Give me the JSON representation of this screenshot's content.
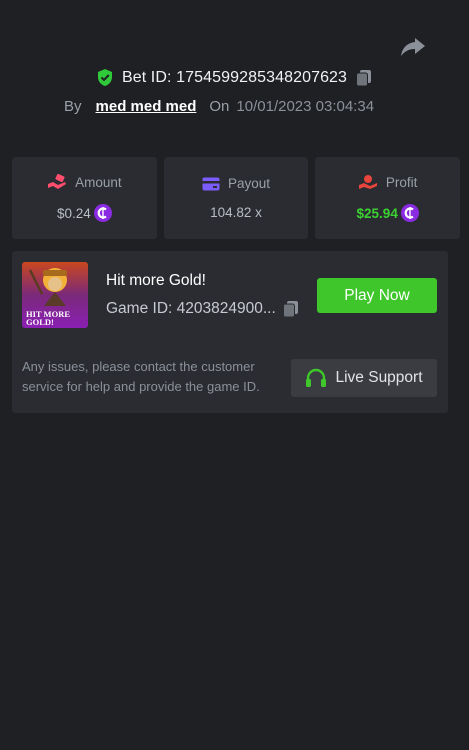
{
  "header": {
    "bet_label": "Bet ID: 1754599285348207623",
    "by_label": "By",
    "username": "med med med",
    "on_label": "On",
    "datetime": "10/01/2023 03:04:34"
  },
  "stats": {
    "amount": {
      "label": "Amount",
      "value": "$0.24",
      "icon": "hand-coins-icon"
    },
    "payout": {
      "label": "Payout",
      "value": "104.82 x",
      "icon": "card-icon"
    },
    "profit": {
      "label": "Profit",
      "value": "$25.94",
      "icon": "hand-money-icon"
    }
  },
  "game": {
    "thumb_text_1": "HIT MORE",
    "thumb_text_2": "GOLD!",
    "title": "Hit more Gold!",
    "game_id": "Game ID: 4203824900...",
    "play_label": "Play Now",
    "support_text": "Any issues, please contact the customer service for help and provide the game ID.",
    "support_label": "Live Support"
  },
  "colors": {
    "background": "#1f2024",
    "panel": "#2a2c31",
    "accent_green": "#3ec62a",
    "profit_green": "#3cd132",
    "coin_purple": "#8a2be2",
    "amount_icon": "#ff4d6d",
    "payout_icon": "#7c5cff",
    "profit_icon": "#e8453c",
    "verified_green": "#2fc93a"
  }
}
